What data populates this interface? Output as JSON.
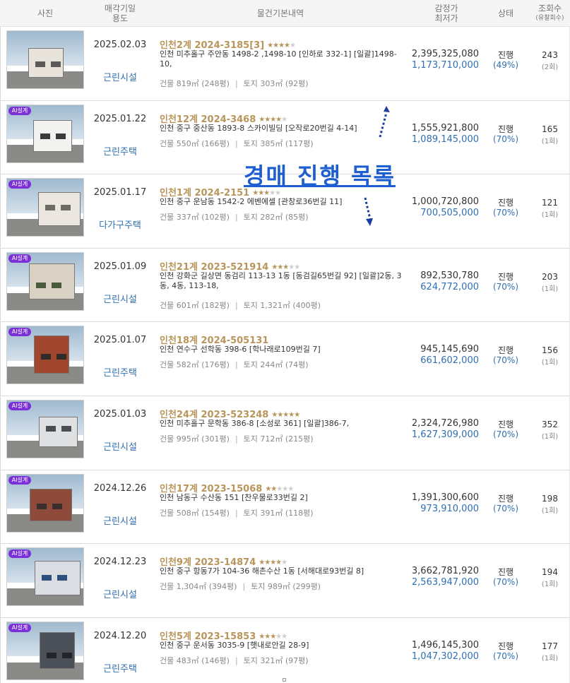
{
  "header": {
    "photo": "사진",
    "date_line1": "매각기일",
    "date_line2": "용도",
    "basic": "물건기본내역",
    "price_line1": "감정가",
    "price_line2": "최저가",
    "status": "상태",
    "views_line1": "조회수",
    "views_line2": "(유찰회수)"
  },
  "overlay": {
    "title": "경매  진행  목록"
  },
  "colors": {
    "case": "#b8955a",
    "accent": "#2f6fb3",
    "badge": "#7b2fd6",
    "overlay": "#1d5fd0"
  },
  "rows": [
    {
      "ai": false,
      "date": "2025.02.03",
      "use": "근린시설",
      "case": "인천2계 2024-3185[3]",
      "stars": 3.5,
      "addr": "인천 미추홀구 주안동 1498-2 ,1498-10 [인하로 332-1]  [일괄]1498-10,",
      "building": "건물 819㎡ (248평)",
      "land": "토지 303㎡ (92평)",
      "appraisal": "2,395,325,080",
      "minimum": "1,173,710,000",
      "status": "진행",
      "pct": "(49%)",
      "views": "243",
      "fails": "(2회)"
    },
    {
      "ai": true,
      "badge": "AI설계",
      "date": "2025.01.22",
      "use": "근린주택",
      "case": "인천12계 2024-3468",
      "stars": 3.5,
      "addr": "인천 중구 중산동 1893-8 스카이빌딩 [오작로20번길 4-14]",
      "building": "건물 550㎡ (166평)",
      "land": "토지 385㎡ (117평)",
      "appraisal": "1,555,921,800",
      "minimum": "1,089,145,000",
      "status": "진행",
      "pct": "(70%)",
      "views": "165",
      "fails": "(1회)"
    },
    {
      "ai": true,
      "badge": "AI설계",
      "date": "2025.01.17",
      "use": "다가구주택",
      "case": "인천1계 2024-2151",
      "stars": 3,
      "addr": "인천 중구 운남동 1542-2 에벤에셀 [관창로36번길 11]",
      "building": "건물 337㎡ (102평)",
      "land": "토지 282㎡ (85평)",
      "appraisal": "1,000,720,800",
      "minimum": "700,505,000",
      "status": "진행",
      "pct": "(70%)",
      "views": "121",
      "fails": "(1회)"
    },
    {
      "ai": true,
      "badge": "AI설계",
      "date": "2025.01.09",
      "use": "근린시설",
      "case": "인천21계 2023-521914",
      "stars": 3,
      "addr": "인천 강화군 길상면 동검리 113-13 1동 [동검길65번길 92]  [일괄]2동, 3동, 4동, 113-18,",
      "building": "건물 601㎡ (182평)",
      "land": "토지 1,321㎡ (400평)",
      "appraisal": "892,530,780",
      "minimum": "624,772,000",
      "status": "진행",
      "pct": "(70%)",
      "views": "203",
      "fails": "(1회)"
    },
    {
      "ai": true,
      "badge": "AI설계",
      "date": "2025.01.07",
      "use": "근린주택",
      "case": "인천18계 2024-505131",
      "stars": 0,
      "addr": "인천 연수구 선학동 398-6 [학나래로109번길 7]",
      "building": "건물 582㎡ (176평)",
      "land": "토지 244㎡ (74평)",
      "appraisal": "945,145,690",
      "minimum": "661,602,000",
      "status": "진행",
      "pct": "(70%)",
      "views": "156",
      "fails": "(1회)"
    },
    {
      "ai": true,
      "badge": "AI설계",
      "date": "2025.01.03",
      "use": "근린시설",
      "case": "인천24계 2023-523248",
      "stars": 4.5,
      "addr": "인천 미추홀구 문학동 386-8 [소성로 361]  [일괄]386-7,",
      "building": "건물 995㎡ (301평)",
      "land": "토지 712㎡ (215평)",
      "appraisal": "2,324,726,980",
      "minimum": "1,627,309,000",
      "status": "진행",
      "pct": "(70%)",
      "views": "352",
      "fails": "(1회)"
    },
    {
      "ai": true,
      "badge": "AI설계",
      "date": "2024.12.26",
      "use": "근린시설",
      "case": "인천17계 2023-15068",
      "stars": 1.5,
      "addr": "인천 남동구 수산동 151 [찬우물로33번길 2]",
      "building": "건물 508㎡ (154평)",
      "land": "토지 391㎡ (118평)",
      "appraisal": "1,391,300,600",
      "minimum": "973,910,000",
      "status": "진행",
      "pct": "(70%)",
      "views": "198",
      "fails": "(1회)"
    },
    {
      "ai": true,
      "badge": "AI설계",
      "date": "2024.12.23",
      "use": "근린시설",
      "case": "인천9계 2023-14874",
      "stars": 3.5,
      "addr": "인천 중구 항동7가 104-36 해촌수산 1동 [서해대로93번길 8]",
      "building": "건물 1,304㎡ (394평)",
      "land": "토지 989㎡ (299평)",
      "appraisal": "3,662,781,920",
      "minimum": "2,563,947,000",
      "status": "진행",
      "pct": "(70%)",
      "views": "194",
      "fails": "(1회)"
    },
    {
      "ai": true,
      "badge": "AI설계",
      "date": "2024.12.20",
      "use": "근린주택",
      "case": "인천5계 2023-15853",
      "stars": 3,
      "addr": "인천 중구 운서동 3035-9 [햇내로안길 28-9]",
      "building": "건물 483㎡ (146평)",
      "land": "토지 321㎡ (97평)",
      "appraisal": "1,496,145,300",
      "minimum": "1,047,302,000",
      "status": "진행",
      "pct": "(70%)",
      "views": "177",
      "fails": "(1회)"
    }
  ]
}
